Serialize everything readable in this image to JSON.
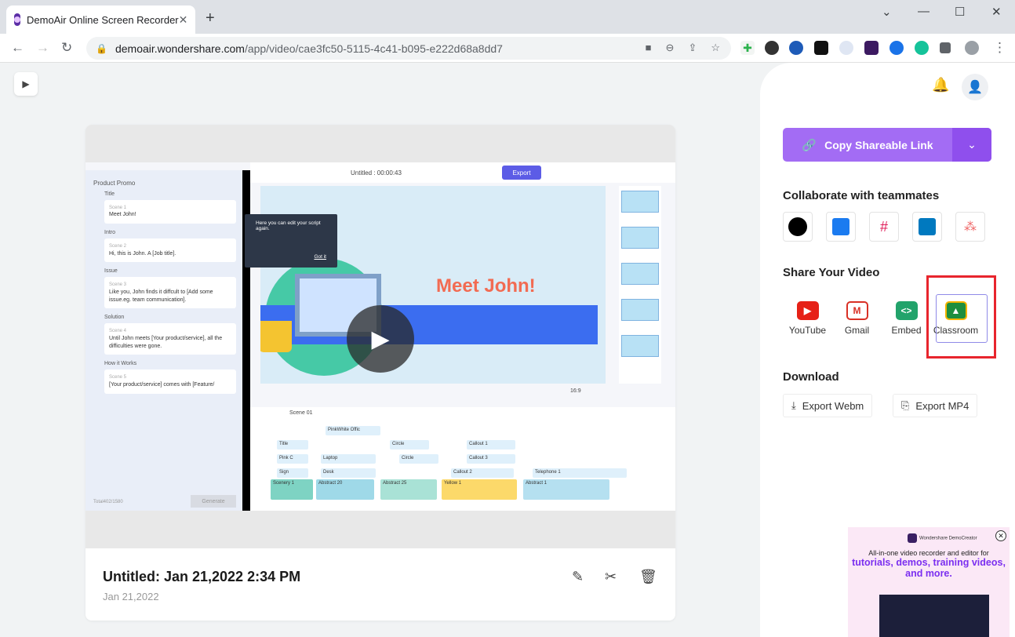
{
  "browser": {
    "tab_title": "DemoAir Online Screen Recorder",
    "url_host": "demoair.wondershare.com",
    "url_path": "/app/video/cae3fc50-5115-4c41-b095-e222d68a8dd7"
  },
  "video": {
    "title": "Untitled: Jan 21,2022 2:34 PM",
    "date": "Jan 21,2022"
  },
  "preview": {
    "editor_title": "Untitled : 00:00:43",
    "export_label": "Export",
    "panel_title": "Product Promo",
    "tooltip_text": "Here you can edit your script again.",
    "tooltip_button": "Got it",
    "headline": "Meet John!",
    "sections": [
      {
        "label": "Title",
        "scene": "Scene 1",
        "text": "Meet John!"
      },
      {
        "label": "Intro",
        "scene": "Scene 2",
        "text": "Hi, this is John. A [Job title]."
      },
      {
        "label": "Issue",
        "scene": "Scene 3",
        "text": "Like you, John finds it diffcult to [Add some issue.eg. team communication]."
      },
      {
        "label": "Solution",
        "scene": "Scene 4",
        "text": "Until John meets [Your product/service], all the difficulties were gone."
      },
      {
        "label": "How it Works",
        "scene": "Scene 5",
        "text": "[Your product/service] comes with [Feature/"
      }
    ],
    "total": "Total402/1580",
    "generate": "Generate",
    "ratio": "16:9",
    "scene_tab": "Scene 01",
    "tracks": [
      "Title",
      "Pink C",
      "Sign",
      "Laptop",
      "Desk",
      "Circle",
      "Circle",
      "Callout 1",
      "Callout 3",
      "Callout 2",
      "Telephone 1",
      "PinkWhite Offic",
      "Scenery 1",
      "Abstract 20",
      "Abstract 25",
      "Yellow 1",
      "Abstract 1"
    ]
  },
  "sidebar": {
    "copy_link_label": "Copy Shareable Link",
    "collaborate_heading": "Collaborate with teammates",
    "collab_icons": [
      "github-icon",
      "microsoft-teams-icon",
      "slack-icon",
      "trello-icon",
      "asana-icon"
    ],
    "share_heading": "Share Your Video",
    "share_options": [
      {
        "label": "YouTube",
        "icon": "youtube-icon",
        "color": "#e62117"
      },
      {
        "label": "Gmail",
        "icon": "gmail-icon",
        "color": "#d93025"
      },
      {
        "label": "Embed",
        "icon": "embed-icon",
        "color": "#22a36b"
      },
      {
        "label": "Classroom",
        "icon": "google-classroom-icon",
        "color": "#1e8e3e"
      }
    ],
    "download_heading": "Download",
    "export_webm": "Export Webm",
    "export_mp4": "Export MP4"
  },
  "ad": {
    "brand": "Wondershare DemoCreator",
    "line1": "All-in-one video recorder and editor for",
    "line2": "tutorials, demos, training videos, and more."
  },
  "colors": {
    "accent": "#a36cf4",
    "accent_dark": "#8f4fed",
    "highlight": "#e8252d"
  }
}
